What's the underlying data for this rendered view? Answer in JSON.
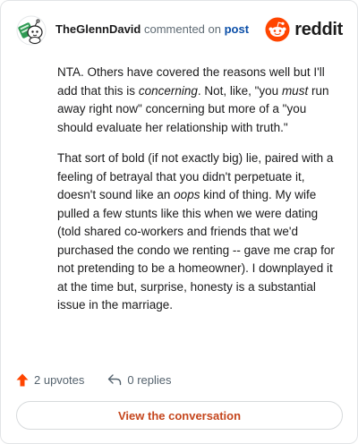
{
  "header": {
    "author": "TheGlennDavid",
    "commented_text": "commented on",
    "post_link": "post",
    "brand": "reddit"
  },
  "comment": {
    "p1_a": "NTA. Others have covered the reasons well but I'll add that this is ",
    "p1_em1": "concerning",
    "p1_b": ". Not, like, \"you ",
    "p1_em2": "must",
    "p1_c": " run away right now\" concerning but more of a \"you should evaluate her relationship with truth.\"",
    "p2_a": "That sort of bold (if not exactly big) lie, paired with a feeling of betrayal that you didn't perpetuate it, doesn't sound like an ",
    "p2_em": "oops",
    "p2_b": " kind of thing. My wife pulled a few stunts like this when we were dating (told shared co-workers and friends that we'd purchased the condo we renting -- gave me crap for not pretending to be a homeowner). I downplayed it at the time but, surprise, honesty is a substantial issue in the marriage."
  },
  "actions": {
    "upvotes": "2 upvotes",
    "replies": "0 replies"
  },
  "cta": {
    "label": "View the conversation"
  },
  "colors": {
    "upvote": "#ff4500",
    "link": "#0b4fa8",
    "cta_text": "#c5461d",
    "brand": "#ff4500"
  },
  "icons": {
    "avatar": "snoo-avatar-icon",
    "brand": "reddit-logo-icon",
    "upvote": "upvote-arrow-icon",
    "reply": "reply-arrow-icon"
  }
}
